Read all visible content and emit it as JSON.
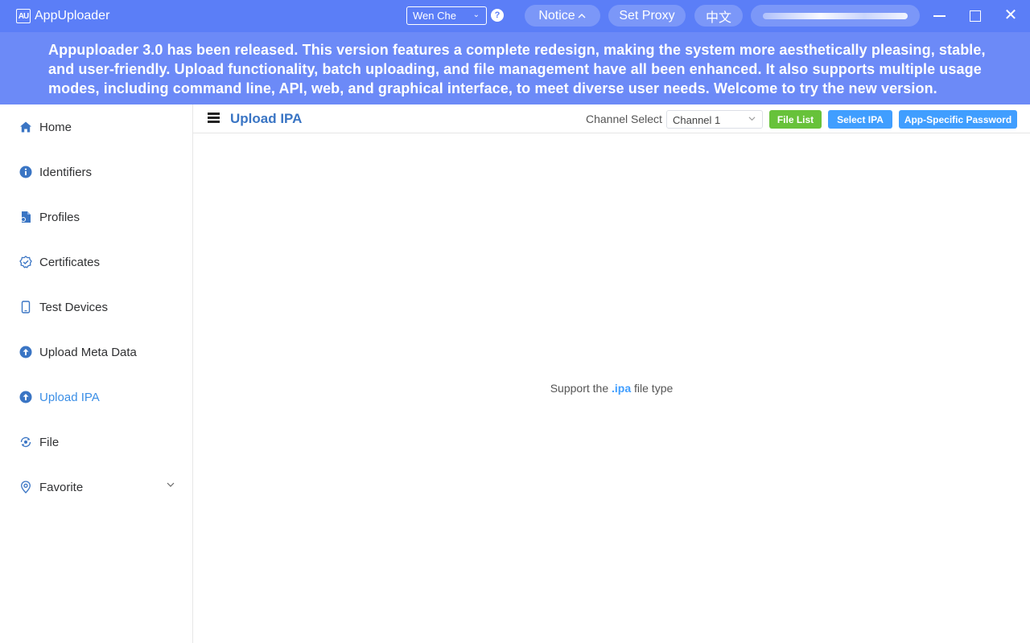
{
  "titlebar": {
    "app_title": "AppUploader",
    "logo_text": "AU",
    "user_select": "Wen Che",
    "help_icon": "?",
    "notice_label": "Notice",
    "set_proxy_label": "Set Proxy",
    "language_label": "中文",
    "close_symbol": "✕"
  },
  "banner": {
    "text": "Appuploader 3.0 has been released. This version features a complete redesign, making the system more aesthetically pleasing, stable, and user-friendly. Upload functionality, batch uploading, and file management have all been enhanced. It also supports multiple usage modes, including command line, API, web, and graphical interface, to meet diverse user needs. Welcome to try the new version."
  },
  "sidebar": {
    "items": [
      {
        "label": "Home",
        "icon": "home-icon"
      },
      {
        "label": "Identifiers",
        "icon": "info-icon"
      },
      {
        "label": "Profiles",
        "icon": "profile-file-icon"
      },
      {
        "label": "Certificates",
        "icon": "certificate-badge-icon"
      },
      {
        "label": "Test Devices",
        "icon": "phone-icon"
      },
      {
        "label": "Upload Meta Data",
        "icon": "upload-circle-icon"
      },
      {
        "label": "Upload IPA",
        "icon": "upload-circle-icon",
        "active": true
      },
      {
        "label": "File",
        "icon": "file-sync-icon"
      },
      {
        "label": "Favorite",
        "icon": "location-pin-icon",
        "expandable": true
      }
    ]
  },
  "header": {
    "title": "Upload IPA",
    "channel_label": "Channel Select",
    "channel_value": "Channel 1",
    "file_list_button": "File List",
    "select_ipa_button": "Select IPA",
    "password_button": "App-Specific Password"
  },
  "content": {
    "support_prefix": "Support the",
    "support_ext": ".ipa",
    "support_suffix": "file type"
  },
  "colors": {
    "titlebar": "#5b7ef7",
    "banner": "#6c8af7",
    "primary": "#409eff",
    "success": "#67c23a",
    "title_blue": "#3a75c4"
  }
}
